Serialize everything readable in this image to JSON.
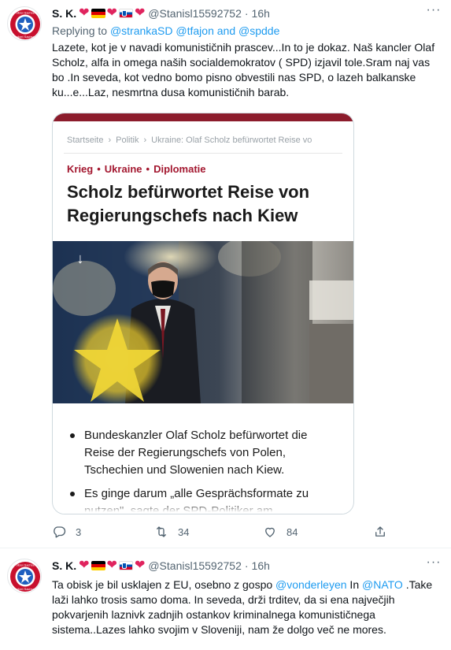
{
  "tweets": [
    {
      "display_name": "S. K.",
      "handle": "@Stanisl15592752",
      "time": "16h",
      "reply_label": "Replying to",
      "reply_mentions": "@strankaSD @tfajon and @spdde",
      "text": "Lazete, kot je v navadi komunističnih prascev...In to je dokaz. Naš kancler Olaf Scholz, alfa in omega naših socialdemokratov ( SPD) izjavil tole.Sram naj vas bo .In seveda, kot vedno bomo pisno obvestili nas SPD, o lazeh balkanske ku...e...Laz, nesmrtna dusa komunističnih barab.",
      "article": {
        "breadcrumbs": [
          "Startseite",
          "Politik",
          "Ukraine: Olaf Scholz befürwortet Reise vo"
        ],
        "tags": [
          "Krieg",
          "Ukraine",
          "Diplomatie"
        ],
        "headline": "Scholz befürwortet Reise von Regierungschefs nach Kiew",
        "bullets": [
          "Bundeskanzler Olaf Scholz befürwortet die Reise der Regierungschefs von Polen, Tschechien und Slowenien nach Kiew.",
          "Es ginge darum „alle Gesprächsformate zu nutzen\", sagte der SPD-Politiker am"
        ]
      },
      "counts": {
        "replies": "3",
        "retweets": "34",
        "likes": "84"
      }
    },
    {
      "display_name": "S. K.",
      "handle": "@Stanisl15592752",
      "time": "16h",
      "text_parts": {
        "a": "Ta obisk je bil usklajen z EU, osebno z gospo ",
        "mention1": "@vonderleyen",
        "b": " In ",
        "mention2": "@NATO",
        "c": " .Take laži lahko trosis samo doma. In seveda, drži trditev, da si ena največjih pokvarjenih laznivk zadnjih ostankov kriminalnega komunističnega sistema..Lazes lahko svojim v Sloveniji, nam že dolgo več ne mores."
      }
    }
  ],
  "sep": "·",
  "more_label": "···",
  "avatar_badge": {
    "top_text": "Polizei Sachsen",
    "bottom_text": "Polizei Sachsen"
  },
  "colors": {
    "accent": "#1d9bf0",
    "like": "#e0245e",
    "muted": "#536471",
    "article_red": "#a3172f"
  },
  "icons": [
    "more-icon",
    "reply-icon",
    "retweet-icon",
    "like-icon",
    "share-icon",
    "arrow-down-icon"
  ]
}
